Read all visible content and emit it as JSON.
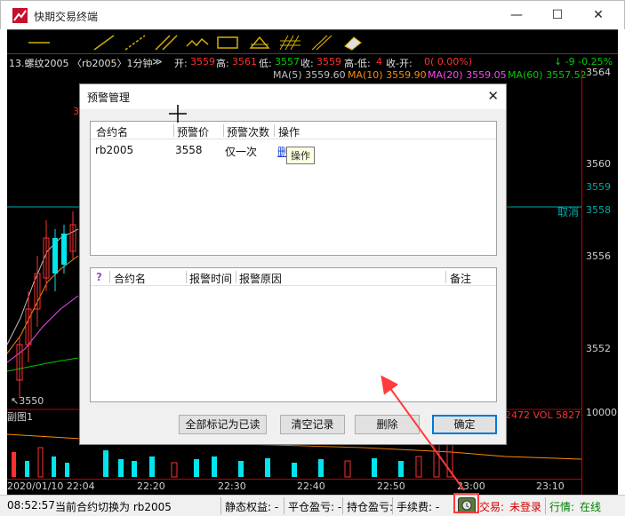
{
  "window": {
    "title": "快期交易终端",
    "minimize": "—",
    "maximize": "☐",
    "close": "✕"
  },
  "toolbar": {
    "tools": [
      "horizontal-line-icon",
      "segment-line-icon",
      "ray-line-icon",
      "parallel-line-icon",
      "polyline-icon",
      "rectangle-icon",
      "triangle-icon",
      "fibonacci-icon",
      "eraser-icon"
    ]
  },
  "chart": {
    "info": {
      "contract": "13.螺纹2005 〈rb2005〉1分钟",
      "dropdown": "≫",
      "open_label": "开:",
      "open": "3559",
      "high_label": "高:",
      "high": "3561",
      "low_label": "低:",
      "low": "3557",
      "close_label": "收:",
      "close": "3559",
      "range_label": "高-低:",
      "range": "4",
      "chg_label": "收-开:",
      "chg": "0( 0.00%)",
      "right_chg": "↓ -9  -0.25%"
    },
    "ma": [
      {
        "text": "MA(5) 3559.60",
        "color": "#c0c0c0"
      },
      {
        "text": "MA(10) 3559.90",
        "color": "#ff8c00"
      },
      {
        "text": "MA(20) 3559.05",
        "color": "#ff44ff"
      },
      {
        "text": "MA(60) 3557.52",
        "color": "#00cc00"
      }
    ],
    "price_labels": [
      "3564",
      "3560",
      "3559",
      "3558",
      "3556",
      "3552",
      "10000"
    ],
    "cancel_label": "取消",
    "marker_3": "3",
    "low_mark": "↖3550",
    "sub_chart_label": "副图1",
    "vol_text": "-2472  VOL 5827",
    "time_labels": [
      "2020/01/10 22:04",
      "22:20",
      "22:30",
      "22:40",
      "22:50",
      "23:00",
      "23:10"
    ],
    "colors": {
      "up": "#ff3030",
      "down": "#00e5ee",
      "axis": "#c00000"
    }
  },
  "statusbar": {
    "time": "08:52:57",
    "message": "当前合约切换为 rb2005",
    "static_equity": "静态权益: -",
    "close_pnl": "平仓盈亏: -",
    "position_pnl": "持仓盈亏: -",
    "fee": "手续费: -",
    "trade_label": "交易:",
    "trade_status": "未登录",
    "market_label": "行情:",
    "market_status": "在线"
  },
  "dialog": {
    "title": "预警管理",
    "close": "✕",
    "alerts": {
      "columns": [
        "合约名",
        "预警价",
        "预警次数",
        "操作"
      ],
      "rows": [
        {
          "contract": "rb2005",
          "price": "3558",
          "count": "仅一次",
          "action": "删除"
        }
      ],
      "tooltip": "操作"
    },
    "records": {
      "columns": [
        "合约名",
        "报警时间",
        "报警原因",
        "备注"
      ]
    },
    "buttons": {
      "mark_read": "全部标记为已读",
      "clear": "清空记录",
      "delete": "删除",
      "ok": "确定"
    }
  }
}
